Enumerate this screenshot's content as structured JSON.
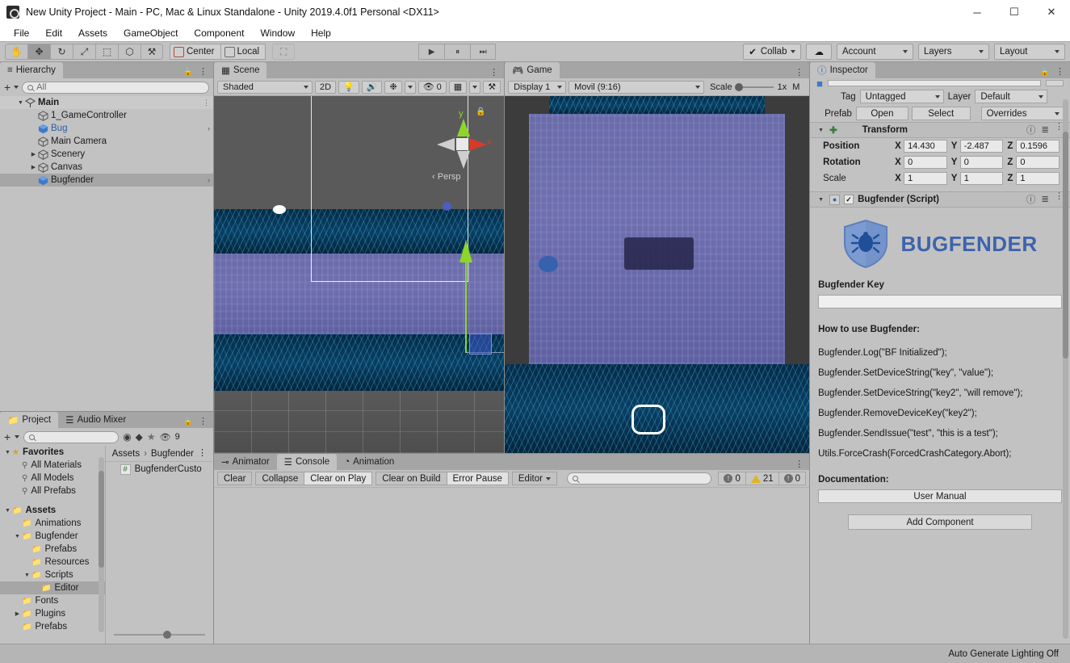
{
  "window": {
    "title": "New Unity Project - Main - PC, Mac & Linux Standalone - Unity 2019.4.0f1 Personal <DX11>",
    "minimize": "─",
    "maximize": "☐",
    "close": "✕"
  },
  "menu": [
    "File",
    "Edit",
    "Assets",
    "GameObject",
    "Component",
    "Window",
    "Help"
  ],
  "toolbar": {
    "tools": [
      {
        "name": "hand-tool",
        "glyph": "✋",
        "active": false
      },
      {
        "name": "move-tool",
        "glyph": "✥",
        "active": true
      },
      {
        "name": "rotate-tool",
        "glyph": "↻",
        "active": false
      },
      {
        "name": "scale-tool",
        "glyph": "⤢",
        "active": false
      },
      {
        "name": "rect-tool",
        "glyph": "⬚",
        "active": false
      },
      {
        "name": "transform-tool",
        "glyph": "⬡",
        "active": false
      },
      {
        "name": "custom-tool",
        "glyph": "⚒",
        "active": false
      }
    ],
    "pivot": "Center",
    "handle": "Local",
    "grid_snap": "⛶",
    "play": "▶",
    "pause": "⏸",
    "step": "⏭",
    "collab": "Collab",
    "cloud": "☁",
    "account": "Account",
    "layers": "Layers",
    "layout": "Layout"
  },
  "hierarchy": {
    "tab": "Hierarchy",
    "add_label": "+",
    "search_placeholder": "All",
    "items": [
      {
        "label": "Main",
        "depth": 0,
        "expanded": true,
        "root": true,
        "selected": false,
        "prefab": false,
        "chevron": false
      },
      {
        "label": "1_GameController",
        "depth": 1,
        "expanded": null,
        "root": false,
        "selected": false,
        "prefab": false,
        "chevron": false
      },
      {
        "label": "Bug",
        "depth": 1,
        "expanded": null,
        "root": false,
        "selected": false,
        "prefab": true,
        "chevron": true
      },
      {
        "label": "Main Camera",
        "depth": 1,
        "expanded": null,
        "root": false,
        "selected": false,
        "prefab": false,
        "chevron": false
      },
      {
        "label": "Scenery",
        "depth": 1,
        "expanded": false,
        "root": false,
        "selected": false,
        "prefab": false,
        "chevron": false
      },
      {
        "label": "Canvas",
        "depth": 1,
        "expanded": false,
        "root": false,
        "selected": false,
        "prefab": false,
        "chevron": false
      },
      {
        "label": "Bugfender",
        "depth": 1,
        "expanded": null,
        "root": false,
        "selected": true,
        "prefab": true,
        "chevron": true
      }
    ]
  },
  "scene": {
    "tab": "Scene",
    "shading": "Shaded",
    "mode_2d": "2D",
    "light_icon": "⚬",
    "audio_icon": "ὐA",
    "fx_icon": "❆",
    "gizmo_count": "0",
    "grid_icon": "⛶",
    "tools_icon": "⚒",
    "axis_x": "x",
    "axis_y": "y",
    "persp_label": "Persp"
  },
  "game": {
    "tab": "Game",
    "display": "Display 1",
    "aspect": "Movil (9:16)",
    "scale_label": "Scale",
    "scale_value": "1x",
    "maximize_label": "M"
  },
  "inspector": {
    "tab": "Inspector",
    "tag_label": "Tag",
    "tag_value": "Untagged",
    "layer_label": "Layer",
    "layer_value": "Default",
    "prefab_label": "Prefab",
    "prefab_open": "Open",
    "prefab_select": "Select",
    "prefab_overrides": "Overrides",
    "transform": {
      "title": "Transform",
      "rows": [
        {
          "label": "Position",
          "x": "14.430",
          "y": "-2.487",
          "z": "0.1596"
        },
        {
          "label": "Rotation",
          "x": "0",
          "y": "0",
          "z": "0"
        },
        {
          "label": "Scale",
          "x": "1",
          "y": "1",
          "z": "1"
        }
      ]
    },
    "script": {
      "title": "Bugfender (Script)",
      "logo_text": "BUGFENDER",
      "key_label": "Bugfender Key",
      "key_value": "",
      "howto_title": "How to use Bugfender:",
      "code_lines": [
        "Bugfender.Log(\"BF Initialized\");",
        "Bugfender.SetDeviceString(\"key\", \"value\");",
        "Bugfender.SetDeviceString(\"key2\", \"will remove\");",
        "Bugfender.RemoveDeviceKey(\"key2\");",
        "Bugfender.SendIssue(\"test\", \"this is a test\");",
        "Utils.ForceCrash(ForcedCrashCategory.Abort);"
      ],
      "doc_title": "Documentation:",
      "doc_button": "User Manual"
    },
    "add_component": "Add Component"
  },
  "project": {
    "tab": "Project",
    "audio_mixer_tab": "Audio Mixer",
    "add_label": "+",
    "search_placeholder": "",
    "hidden_count": "9",
    "favorites_label": "Favorites",
    "favorites": [
      "All Materials",
      "All Models",
      "All Prefabs"
    ],
    "assets_label": "Assets",
    "tree": [
      {
        "label": "Animations",
        "depth": 1,
        "expanded": null,
        "selected": false
      },
      {
        "label": "Bugfender",
        "depth": 1,
        "expanded": true,
        "selected": false
      },
      {
        "label": "Prefabs",
        "depth": 2,
        "expanded": null,
        "selected": false
      },
      {
        "label": "Resources",
        "depth": 2,
        "expanded": null,
        "selected": false
      },
      {
        "label": "Scripts",
        "depth": 2,
        "expanded": true,
        "selected": false
      },
      {
        "label": "Editor",
        "depth": 3,
        "expanded": null,
        "selected": true
      },
      {
        "label": "Fonts",
        "depth": 1,
        "expanded": null,
        "selected": false
      },
      {
        "label": "Plugins",
        "depth": 1,
        "expanded": false,
        "selected": false
      },
      {
        "label": "Prefabs",
        "depth": 1,
        "expanded": null,
        "selected": false
      }
    ],
    "breadcrumb": [
      "Assets",
      "Bugfender"
    ],
    "file": {
      "name": "BugfenderCusto",
      "icon": "#"
    }
  },
  "console": {
    "tabs": [
      {
        "label": "Animator",
        "active": false,
        "icon": "⊸"
      },
      {
        "label": "Console",
        "active": true,
        "icon": "☰"
      },
      {
        "label": "Animation",
        "active": false,
        "icon": "◔"
      }
    ],
    "clear": "Clear",
    "collapse": "Collapse",
    "clear_on_play": "Clear on Play",
    "clear_on_build": "Clear on Build",
    "error_pause": "Error Pause",
    "editor": "Editor",
    "search_placeholder": "",
    "counts": {
      "error": "0",
      "warning": "21",
      "info": "0"
    }
  },
  "statusbar": {
    "text": "Auto Generate Lighting Off"
  },
  "colors": {
    "brand_blue": "#3d63ad",
    "prefab_blue": "#3e79c7",
    "warning_yellow": "#e0b422",
    "axis_x": "#d63b2a",
    "axis_y": "#8cd62a",
    "panel_bg": "#c2c2c2"
  }
}
